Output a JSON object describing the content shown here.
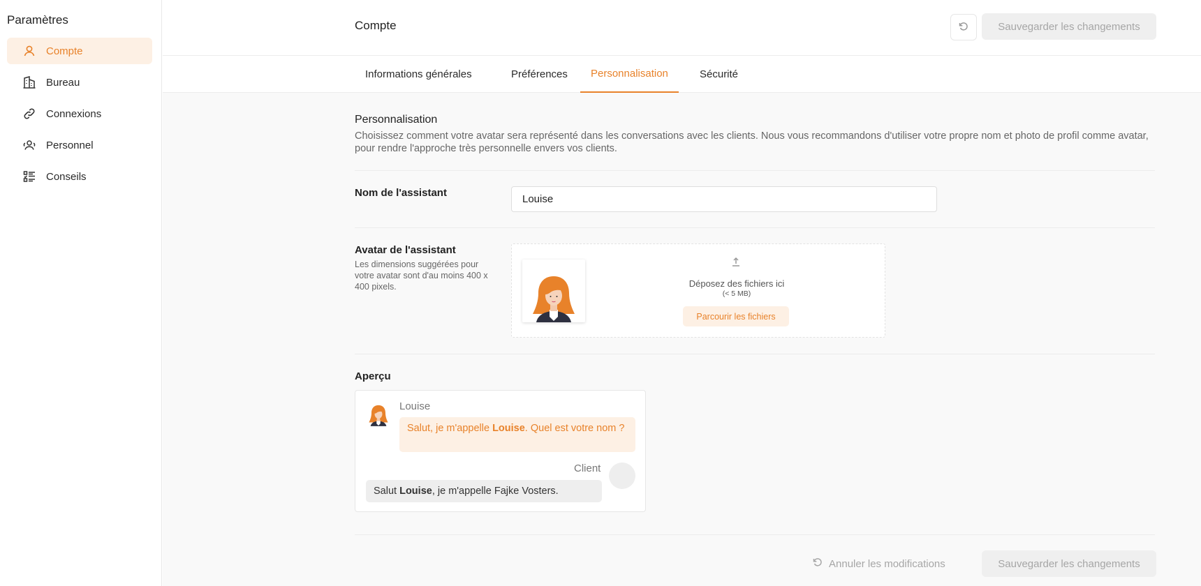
{
  "sidebar": {
    "title": "Paramètres",
    "items": [
      {
        "label": "Compte",
        "icon": "user-icon",
        "active": true
      },
      {
        "label": "Bureau",
        "icon": "building-icon",
        "active": false
      },
      {
        "label": "Connexions",
        "icon": "link-icon",
        "active": false
      },
      {
        "label": "Personnel",
        "icon": "people-icon",
        "active": false
      },
      {
        "label": "Conseils",
        "icon": "checklist-icon",
        "active": false
      }
    ]
  },
  "header": {
    "title": "Compte",
    "save_label": "Sauvegarder les changements",
    "reset_icon": "undo-icon"
  },
  "tabs": [
    {
      "label": "Informations générales",
      "active": false
    },
    {
      "label": "Préférences",
      "active": false
    },
    {
      "label": "Personnalisation",
      "active": true
    },
    {
      "label": "Sécurité",
      "active": false
    }
  ],
  "section": {
    "title": "Personnalisation",
    "description": "Choisissez comment votre avatar sera représenté dans les conversations avec les clients. Nous vous recommandons d'utiliser votre propre nom et photo de profil comme avatar, pour rendre l'approche très personnelle envers vos clients."
  },
  "assistant_name": {
    "label": "Nom de l'assistant",
    "value": "Louise"
  },
  "assistant_avatar": {
    "label": "Avatar de l'assistant",
    "hint": "Les dimensions suggérées pour votre avatar sont d'au moins 400 x 400 pixels.",
    "drop_text": "Déposez des fichiers ici",
    "drop_limit": "(< 5 MB)",
    "browse_label": "Parcourir les fichiers"
  },
  "preview": {
    "label": "Aperçu",
    "bot_name": "Louise",
    "bot_msg_pre": "Salut, je m'appelle ",
    "bot_msg_name": "Louise",
    "bot_msg_post": ". Quel est votre nom ?",
    "client_name": "Client",
    "client_msg_pre": "Salut ",
    "client_msg_name": "Louise",
    "client_msg_post": ", je m'appelle Fajke Vosters."
  },
  "footer": {
    "cancel_label": "Annuler les modifications",
    "save_label": "Sauvegarder les changements"
  },
  "colors": {
    "accent": "#e8822a",
    "accent_bg": "#fdf0e4",
    "disabled_bg": "#efefef",
    "disabled_text": "#a6a6a6"
  }
}
